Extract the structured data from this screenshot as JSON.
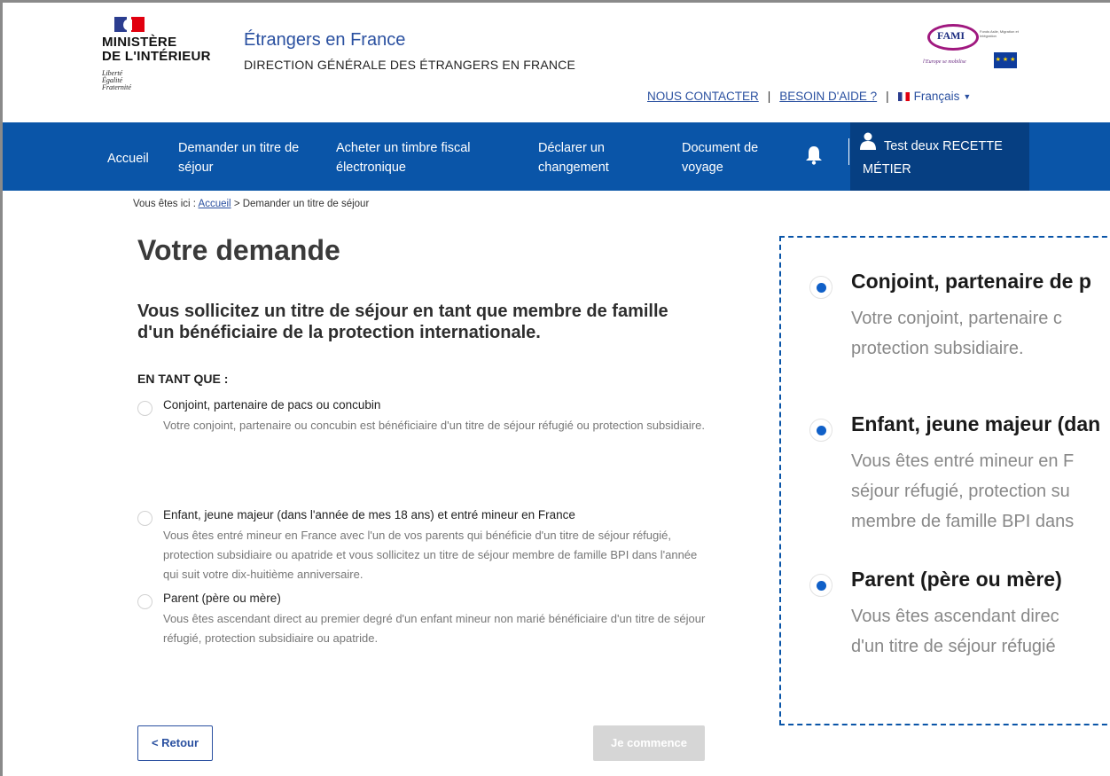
{
  "header": {
    "ministry": "MINISTÈRE\nDE L'INTÉRIEUR",
    "motto": [
      "Liberté",
      "Égalité",
      "Fraternité"
    ],
    "site_title": "Étrangers en France",
    "site_subtitle": "DIRECTION GÉNÉRALE DES ÉTRANGERS EN FRANCE",
    "fami_logo": "FAMI",
    "fami_small": "Fonds Asile, Migration et Intégration",
    "fami_slogan": "l'Europe se mobilise",
    "links": {
      "contact": "NOUS CONTACTER",
      "help": "BESOIN D'AIDE ?",
      "language": "Français",
      "separator": "|"
    }
  },
  "nav": {
    "items": [
      "Accueil",
      "Demander un titre de séjour",
      "Acheter un timbre fiscal électronique",
      "Déclarer un changement",
      "Document de voyage"
    ],
    "user": "Test deux RECETTE MÉTIER"
  },
  "breadcrumb": {
    "prefix": "Vous êtes ici :",
    "home": "Accueil",
    "current": "> Demander un titre de séjour"
  },
  "main": {
    "title": "Votre demande",
    "lead": "Vous sollicitez un titre de séjour en tant que membre de famille d'un bénéficiaire de la protection internationale.",
    "as_label": "EN TANT QUE :",
    "options": [
      {
        "title": "Conjoint, partenaire de pacs ou concubin",
        "description": "Votre conjoint, partenaire ou concubin est bénéficiaire d'un titre de séjour réfugié ou protection subsidiaire."
      },
      {
        "title": "Enfant, jeune majeur (dans l'année de mes 18 ans) et entré mineur en France",
        "description": "Vous êtes entré mineur en France avec l'un de vos parents qui bénéficie d'un titre de séjour réfugié, protection subsidiaire ou apatride et vous sollicitez un titre de séjour membre de famille BPI dans l'année qui suit votre dix-huitième anniversaire."
      },
      {
        "title": "Parent (père ou mère)",
        "description": "Vous êtes ascendant direct au premier degré d'un enfant mineur non marié bénéficiaire d'un titre de séjour réfugié, protection subsidiaire ou apatride."
      }
    ],
    "back_button": "< Retour",
    "start_button": "Je commence"
  },
  "zoom": {
    "items": [
      {
        "title": "Conjoint, partenaire de p",
        "lines": [
          "Votre conjoint, partenaire c",
          "protection subsidiaire."
        ]
      },
      {
        "title": "Enfant, jeune majeur (dan",
        "lines": [
          "Vous êtes entré mineur en F",
          "séjour réfugié, protection su",
          "membre de famille BPI dans"
        ]
      },
      {
        "title": "Parent (père ou mère)",
        "lines": [
          "Vous êtes ascendant direc",
          "d'un titre de séjour réfugié"
        ]
      }
    ]
  },
  "colors": {
    "nav_bg": "#0a55a8",
    "nav_user_bg": "#063f82",
    "link": "#2a50a0",
    "radio_selected": "#1060c8",
    "button_disabled": "#d6d6d6"
  }
}
